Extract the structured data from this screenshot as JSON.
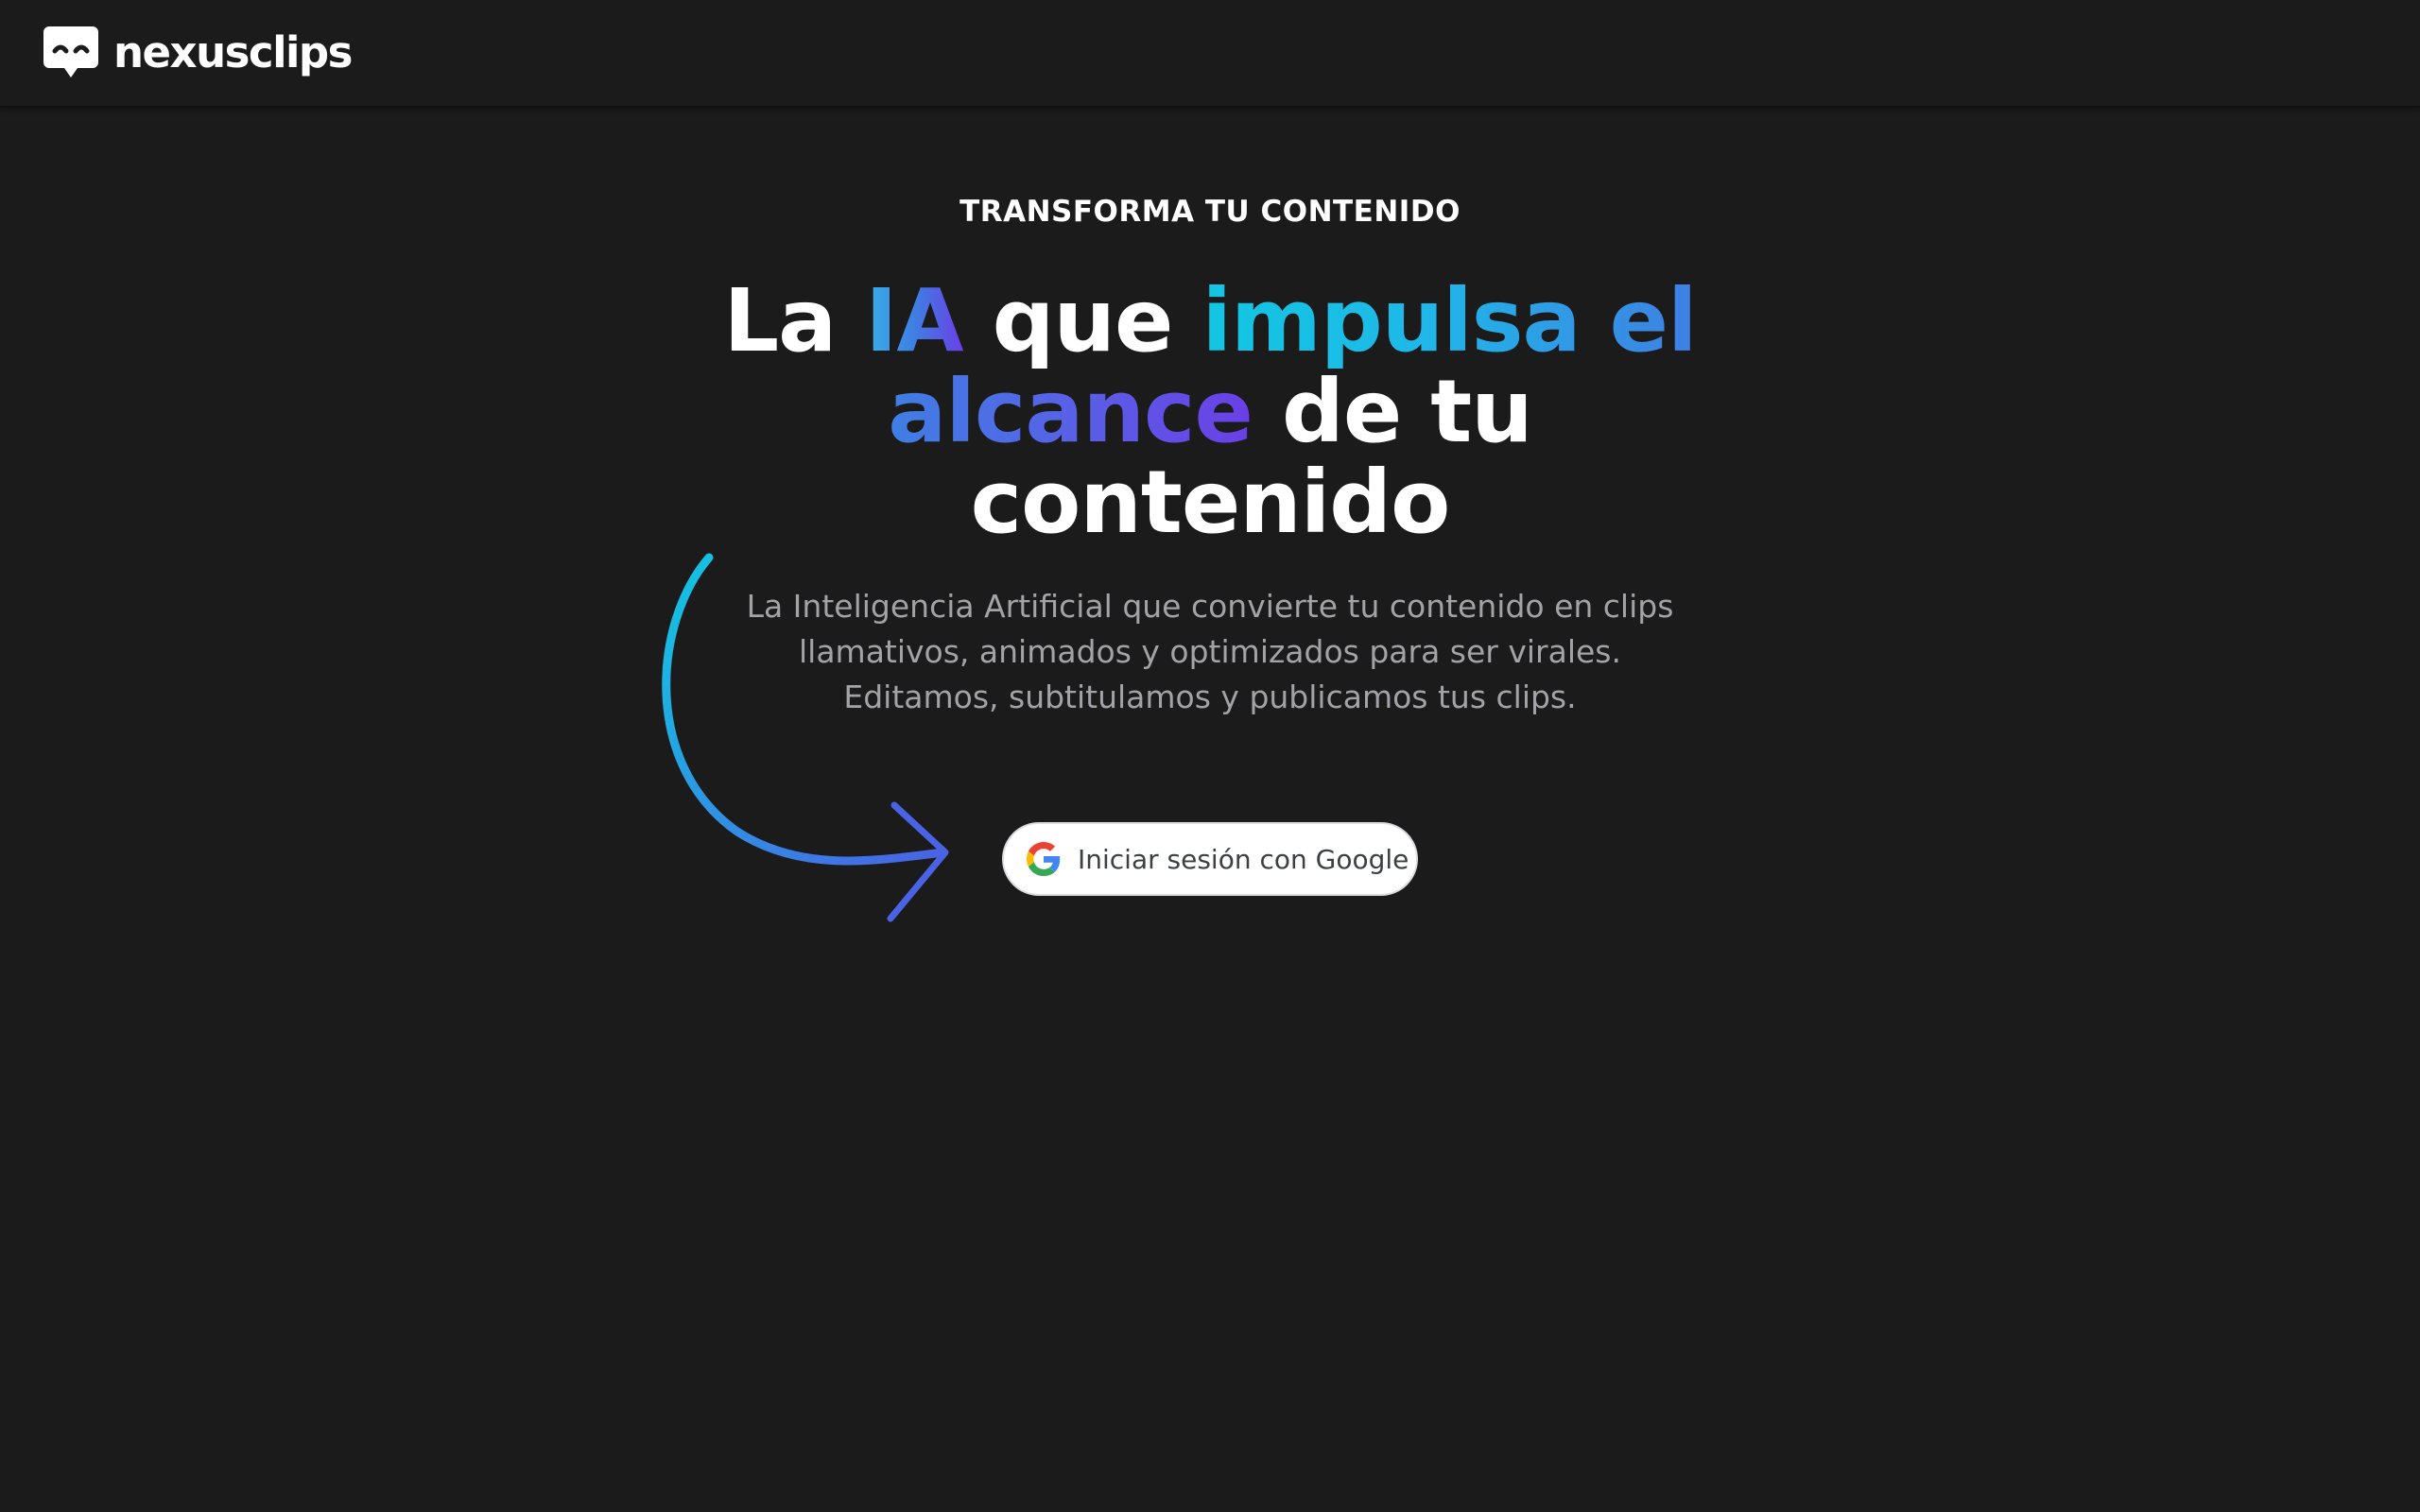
{
  "header": {
    "brand_name": "nexusclips",
    "brand_icon": "speech-bubble-face-icon"
  },
  "hero": {
    "eyebrow": "TRANSFORMA TU CONTENIDO",
    "headline": {
      "part1": "La ",
      "part2": "IA",
      "part3": " que ",
      "part4": "impulsa el",
      "part5": "alcance",
      "part6": " de tu",
      "part7": "contenido"
    },
    "subtitle": "La Inteligencia Artificial que convierte tu contenido en clips llamativos, animados y optimizados para ser virales. Editamos, subtitulamos y publicamos tus clips.",
    "arrow_icon": "curved-arrow-icon"
  },
  "auth": {
    "google_button_label": "Iniciar sesión con Google",
    "google_icon": "google-g-icon"
  },
  "colors": {
    "background": "#1b1b1c",
    "text": "#ffffff",
    "muted_text": "#a3a3a7",
    "gradient_cyan": "#12c6e2",
    "gradient_blue": "#3f7fe3",
    "gradient_purple": "#6a3fe6"
  }
}
